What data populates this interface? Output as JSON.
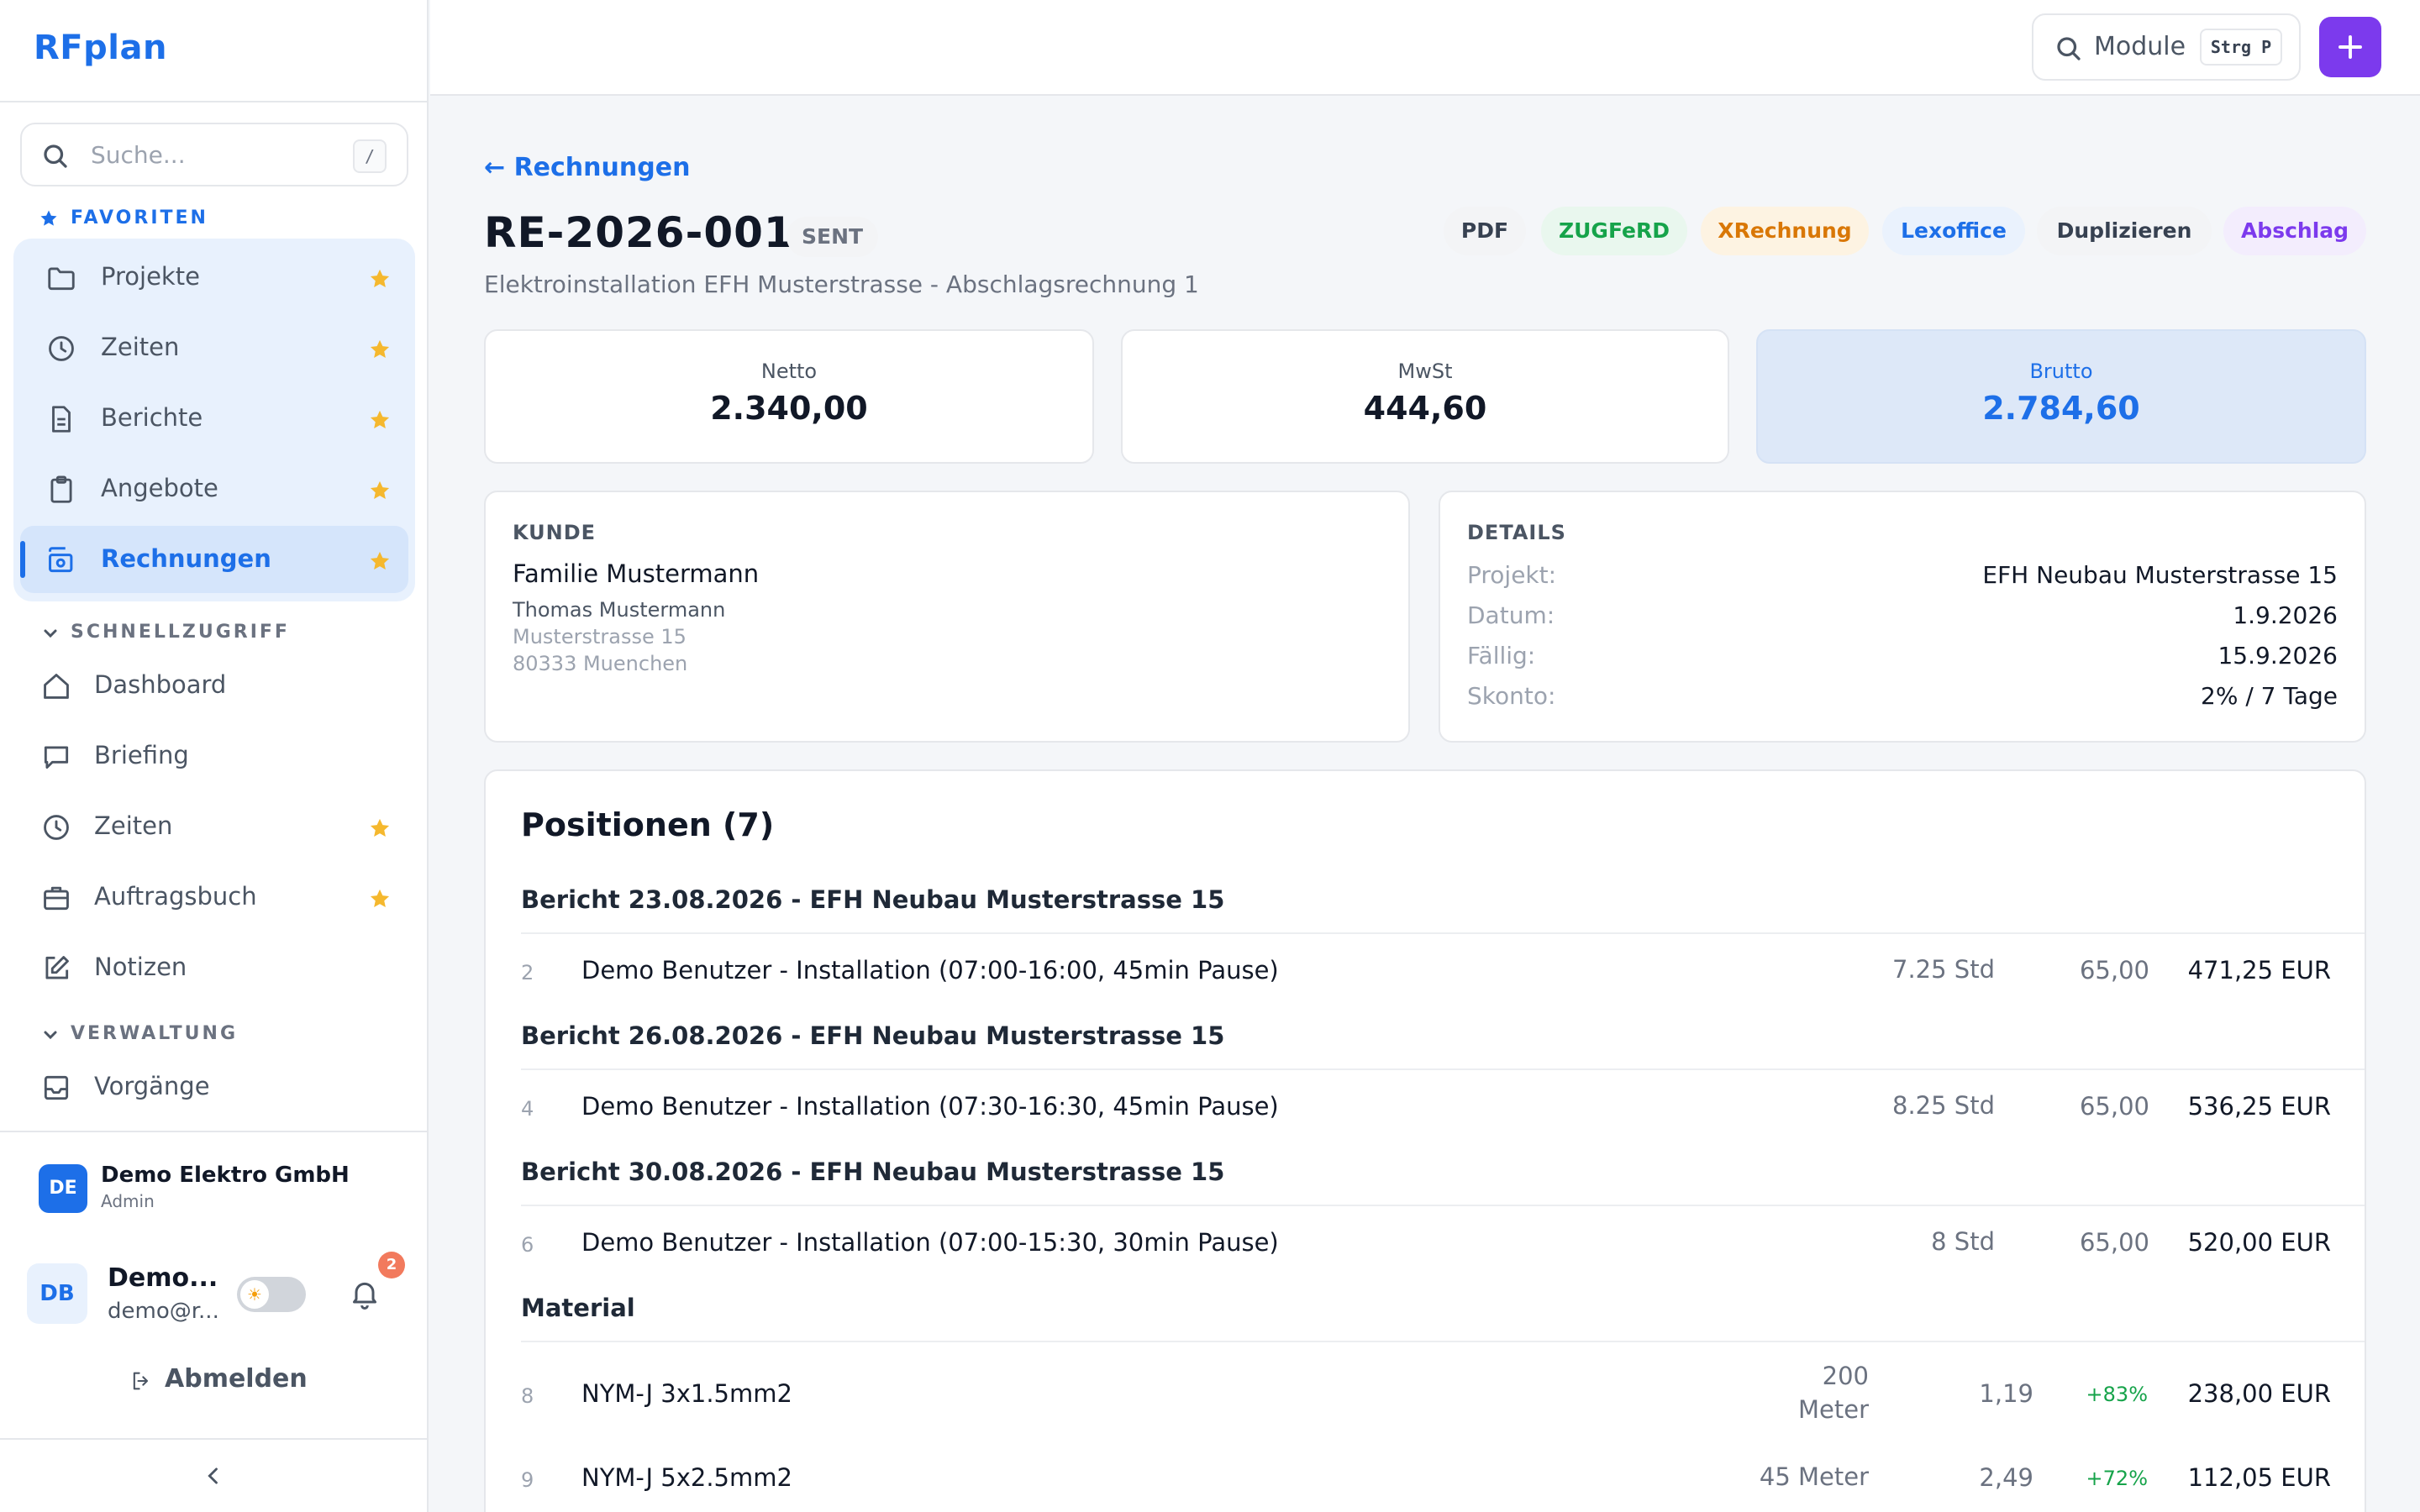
{
  "app": {
    "brand": "RFplan"
  },
  "search": {
    "placeholder": "Suche...",
    "shortcut": "/"
  },
  "favorites": {
    "title": "FAVORITEN",
    "items": [
      {
        "label": "Projekte",
        "icon": "folder-icon"
      },
      {
        "label": "Zeiten",
        "icon": "clock-icon"
      },
      {
        "label": "Berichte",
        "icon": "document-icon"
      },
      {
        "label": "Angebote",
        "icon": "clipboard-icon"
      },
      {
        "label": "Rechnungen",
        "icon": "invoice-icon",
        "active": true
      }
    ]
  },
  "quick": {
    "title": "SCHNELLZUGRIFF",
    "items": [
      {
        "label": "Dashboard",
        "icon": "home-icon"
      },
      {
        "label": "Briefing",
        "icon": "chat-icon"
      },
      {
        "label": "Zeiten",
        "icon": "clock-icon",
        "starred": true
      },
      {
        "label": "Auftragsbuch",
        "icon": "briefcase-icon",
        "starred": true
      },
      {
        "label": "Notizen",
        "icon": "pencil-icon"
      }
    ]
  },
  "admin": {
    "title": "VERWALTUNG",
    "items": [
      {
        "label": "Vorgänge",
        "icon": "inbox-icon"
      }
    ]
  },
  "company": {
    "initials": "DE",
    "name": "Demo Elektro GmbH",
    "role": "Admin"
  },
  "user": {
    "initials": "DB",
    "name": "Demo...",
    "email": "demo@r...",
    "notifications": "2"
  },
  "logout": {
    "label": "Abmelden"
  },
  "topbar": {
    "module_label": "Module",
    "module_shortcut": "Strg P"
  },
  "invoice": {
    "back_label": "← Rechnungen",
    "number": "RE-2026-001",
    "status": "SENT",
    "subtitle": "Elektroinstallation EFH Musterstrasse - Abschlagsrechnung 1",
    "actions": [
      "PDF",
      "ZUGFeRD",
      "XRechnung",
      "Lexoffice",
      "Duplizieren",
      "Abschlag"
    ],
    "action_colors": [
      "#374151",
      "#16a34a",
      "#d97706",
      "#1d6fe8",
      "#374151",
      "#7c3aed"
    ],
    "totals": [
      {
        "label": "Netto",
        "value": "2.340,00"
      },
      {
        "label": "MwSt",
        "value": "444,60"
      },
      {
        "label": "Brutto",
        "value": "2.784,60"
      }
    ],
    "customer": {
      "heading": "KUNDE",
      "name": "Familie Mustermann",
      "contact": "Thomas Mustermann",
      "street": "Musterstrasse 15",
      "city": "80333 Muenchen"
    },
    "details": {
      "heading": "DETAILS",
      "rows": [
        {
          "label": "Projekt:",
          "value": "EFH Neubau Musterstrasse 15"
        },
        {
          "label": "Datum:",
          "value": "1.9.2026"
        },
        {
          "label": "Fällig:",
          "value": "15.9.2026"
        },
        {
          "label": "Skonto:",
          "value": "2% / 7 Tage"
        }
      ]
    },
    "positions": {
      "title": "Positionen (7)",
      "groups": [
        {
          "title": "Bericht 23.08.2026 - EFH Neubau Musterstrasse 15",
          "rows": [
            {
              "nr": "2",
              "desc": "Demo Benutzer - Installation (07:00-16:00, 45min Pause)",
              "qty": "7.25 Std",
              "price": "65,00",
              "total": "471,25 EUR"
            }
          ]
        },
        {
          "title": "Bericht 26.08.2026 - EFH Neubau Musterstrasse 15",
          "rows": [
            {
              "nr": "4",
              "desc": "Demo Benutzer - Installation (07:30-16:30, 45min Pause)",
              "qty": "8.25 Std",
              "price": "65,00",
              "total": "536,25 EUR"
            }
          ]
        },
        {
          "title": "Bericht 30.08.2026 - EFH Neubau Musterstrasse 15",
          "rows": [
            {
              "nr": "6",
              "desc": "Demo Benutzer - Installation (07:00-15:30, 30min Pause)",
              "qty": "8 Std",
              "price": "65,00",
              "total": "520,00 EUR"
            }
          ]
        },
        {
          "title": "Material",
          "rows": [
            {
              "nr": "8",
              "desc": "NYM-J 3x1.5mm2",
              "qty_line1": "200",
              "qty_line2": "Meter",
              "price": "1,19",
              "margin": "+83%",
              "total": "238,00 EUR"
            },
            {
              "nr": "9",
              "desc": "NYM-J 5x2.5mm2",
              "qty": "45 Meter",
              "price": "2,49",
              "margin": "+72%",
              "total": "112,05 EUR"
            }
          ]
        }
      ]
    }
  }
}
